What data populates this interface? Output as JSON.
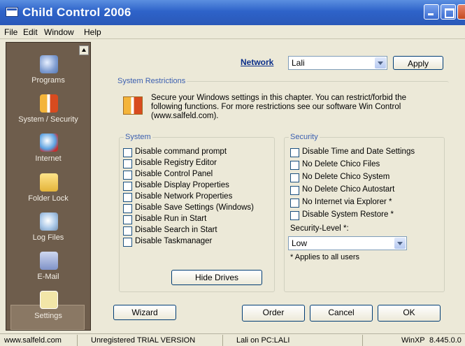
{
  "window": {
    "title": "Child Control 2006"
  },
  "menu": [
    "File",
    "Edit",
    "Window",
    "Help"
  ],
  "sidebar": {
    "items": [
      {
        "label": "Programs",
        "icon": "programs-icon"
      },
      {
        "label": "System / Security",
        "icon": "system-security-icon"
      },
      {
        "label": "Internet",
        "icon": "internet-icon"
      },
      {
        "label": "Folder Lock",
        "icon": "folder-lock-icon"
      },
      {
        "label": "Log Files",
        "icon": "log-files-icon"
      },
      {
        "label": "E-Mail",
        "icon": "email-icon"
      },
      {
        "label": "Settings",
        "icon": "settings-icon"
      }
    ]
  },
  "header": {
    "network_label": "Network",
    "user_value": "Lali",
    "apply_label": "Apply"
  },
  "restrictions": {
    "group_label": "System Restrictions",
    "info": "Secure your Windows settings in this chapter. You can restrict/forbid the following functions. For more restrictions see our software Win Control (www.salfeld.com)."
  },
  "system": {
    "group_label": "System",
    "items": [
      "Disable command prompt",
      "Disable Registry Editor",
      "Disable Control Panel",
      "Disable Display Properties",
      "Disable Network Properties",
      "Disable Save Settings (Windows)",
      "Disable Run in Start",
      "Disable Search in Start",
      "Disable Taskmanager"
    ],
    "hide_drives_label": "Hide Drives"
  },
  "security": {
    "group_label": "Security",
    "items": [
      "Disable Time and Date Settings",
      "No Delete Chico Files",
      "No Delete Chico System",
      "No Delete Chico Autostart",
      "No Internet via Explorer *",
      "Disable System Restore *"
    ],
    "level_label": "Security-Level *:",
    "level_value": "Low",
    "note": "* Applies to all users"
  },
  "buttons": {
    "wizard": "Wizard",
    "order": "Order",
    "cancel": "Cancel",
    "ok": "OK"
  },
  "status": {
    "website": "www.salfeld.com",
    "version": "Unregistered TRIAL VERSION",
    "user": "Lali on PC:LALI",
    "os": "WinXP",
    "build": "8.445.0.0"
  }
}
